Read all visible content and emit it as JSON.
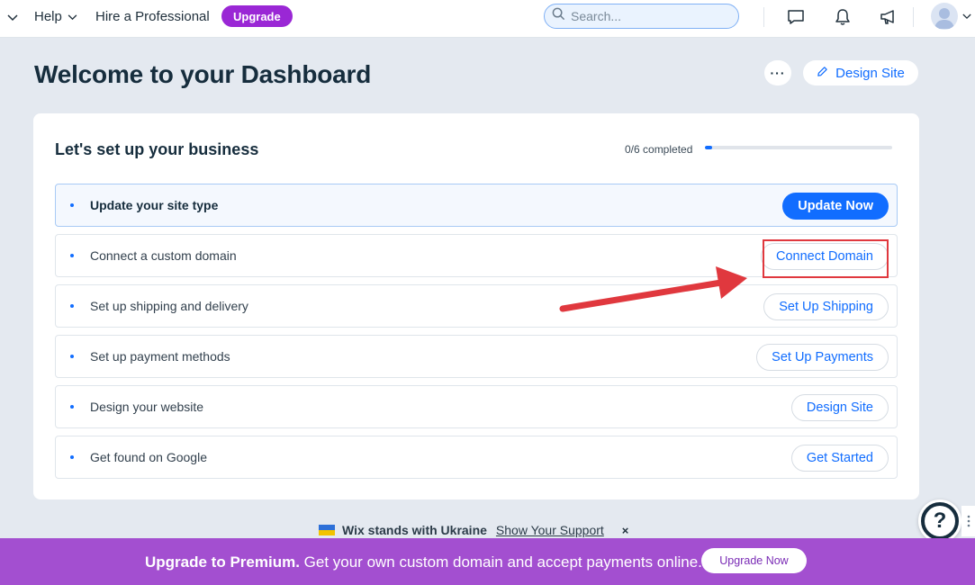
{
  "topbar": {
    "help_label": "Help",
    "hire_label": "Hire a Professional",
    "upgrade_label": "Upgrade",
    "search_placeholder": "Search..."
  },
  "header": {
    "title": "Welcome to your Dashboard",
    "more_label": "···",
    "design_site_label": "Design Site"
  },
  "setup": {
    "title": "Let's set up your business",
    "progress_text": "0/6 completed",
    "progress_value": 0.04,
    "tasks": [
      {
        "label": "Update your site type",
        "button": "Update Now",
        "active": true
      },
      {
        "label": "Connect a custom domain",
        "button": "Connect Domain",
        "active": false
      },
      {
        "label": "Set up shipping and delivery",
        "button": "Set Up Shipping",
        "active": false
      },
      {
        "label": "Set up payment methods",
        "button": "Set Up Payments",
        "active": false
      },
      {
        "label": "Design your website",
        "button": "Design Site",
        "active": false
      },
      {
        "label": "Get found on Google",
        "button": "Get Started",
        "active": false
      }
    ]
  },
  "ukraine": {
    "text": "Wix stands with Ukraine",
    "link": "Show Your Support",
    "close": "×"
  },
  "help_bubble": {
    "label": "?"
  },
  "banner": {
    "bold": "Upgrade to Premium.",
    "text": " Get your own custom domain and accept payments online.",
    "button": "Upgrade Now"
  },
  "icons": {
    "chat": "chat-bubble-icon",
    "bell": "bell-icon",
    "megaphone": "megaphone-icon",
    "search": "search-icon",
    "pencil": "pencil-icon"
  },
  "colors": {
    "accent": "#116dff",
    "upgrade": "#9a27d5",
    "banner": "#a34fd0",
    "annotation": "#e0383e"
  }
}
